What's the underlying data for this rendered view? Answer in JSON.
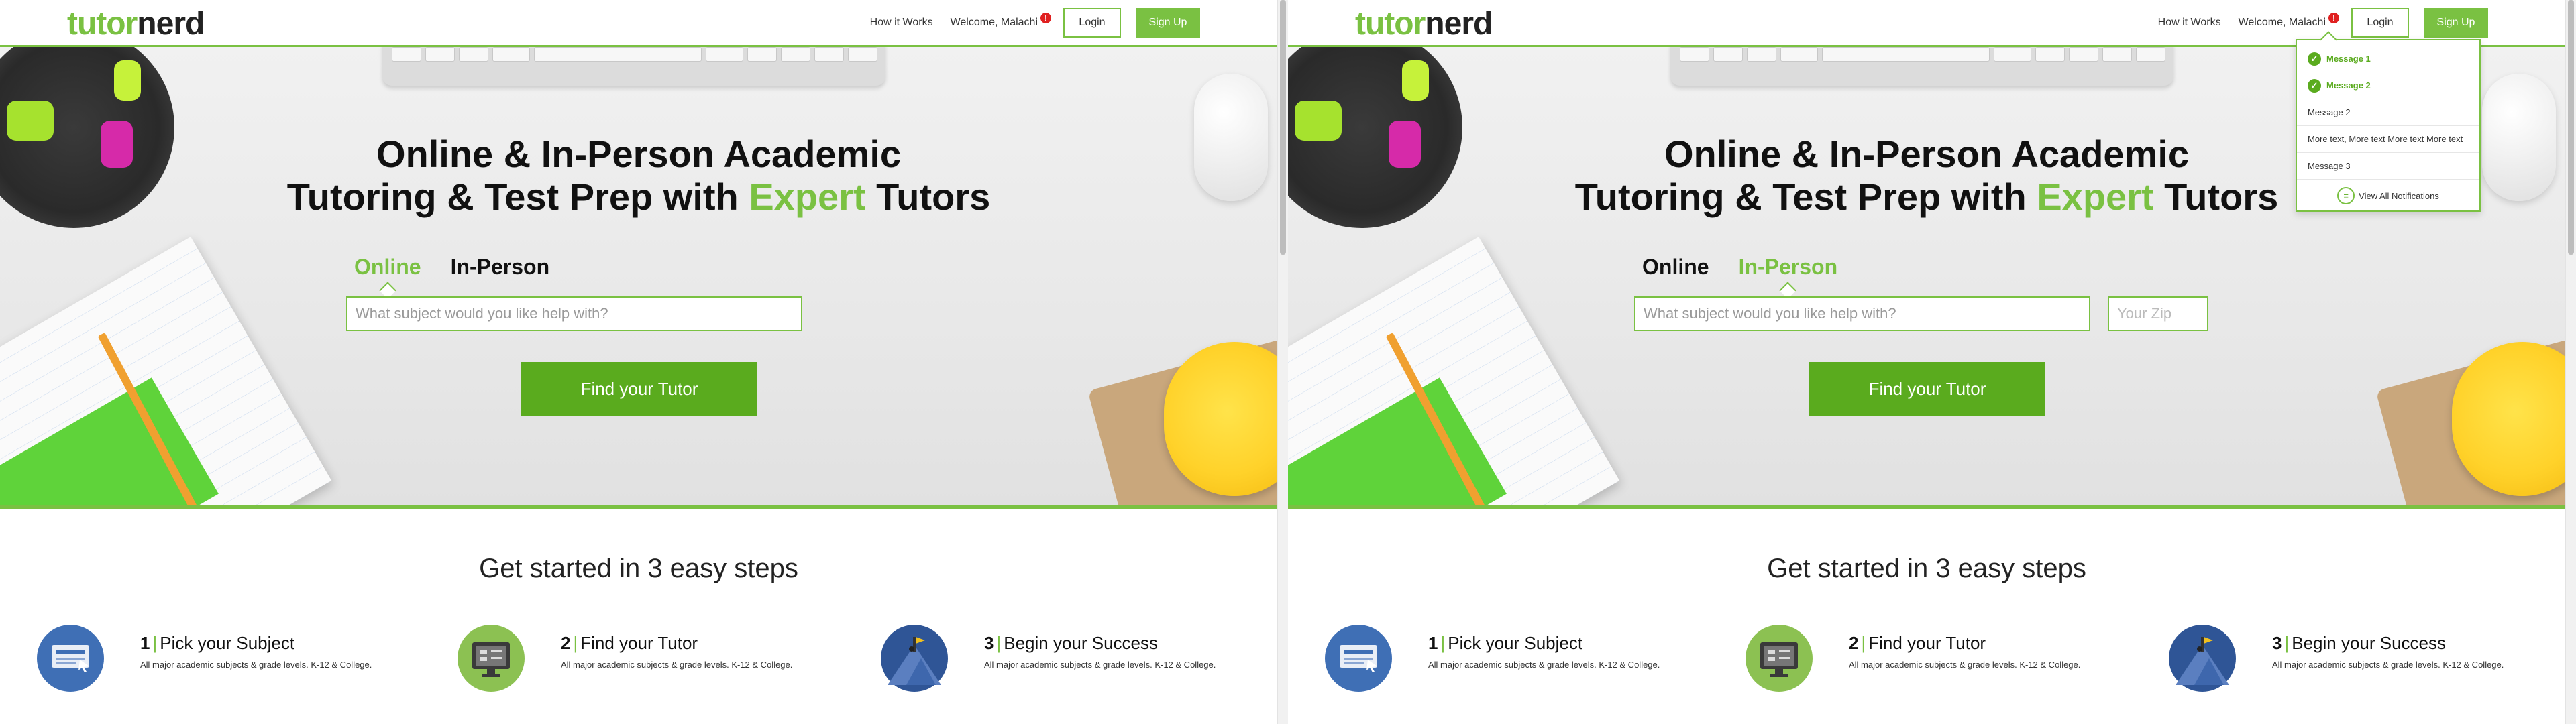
{
  "brand": {
    "logo_part1": "tutor",
    "logo_part2": "nerd"
  },
  "nav": {
    "how_it_works": "How it Works",
    "welcome": "Welcome, Malachi",
    "notification_badge": "!",
    "login": "Login",
    "signup": "Sign Up"
  },
  "hero": {
    "headline_line1": "Online & In-Person Academic",
    "headline_line2_pre": "Tutoring & Test Prep with ",
    "headline_accent": "Expert",
    "headline_line2_post": " Tutors",
    "tab_online": "Online",
    "tab_in_person": "In-Person",
    "subject_placeholder": "What subject would you like help with?",
    "zip_placeholder": "Your Zip",
    "find_button": "Find your Tutor"
  },
  "panels": [
    {
      "active_tab": "online",
      "show_zip": false,
      "show_dropdown": false
    },
    {
      "active_tab": "in-person",
      "show_zip": true,
      "show_dropdown": true
    }
  ],
  "steps": {
    "title": "Get started in 3 easy steps",
    "items": [
      {
        "number": "1",
        "label": "Pick your Subject",
        "desc": "All major academic subjects & grade levels. K-12 & College."
      },
      {
        "number": "2",
        "label": "Find your Tutor",
        "desc": "All major academic subjects & grade levels. K-12 & College."
      },
      {
        "number": "3",
        "label": "Begin your Success",
        "desc": "All major academic subjects & grade levels. K-12 & College."
      }
    ]
  },
  "notifications": {
    "items": [
      {
        "text": "Message 1",
        "unread": true
      },
      {
        "text": "Message 2",
        "unread": true
      },
      {
        "text": "Message 2",
        "unread": false
      },
      {
        "text": "More text, More text More text More text",
        "unread": false
      },
      {
        "text": "Message 3",
        "unread": false
      }
    ],
    "view_all": "View All Notifications"
  },
  "colors": {
    "brand_green": "#7ac142",
    "button_green": "#5aab1e",
    "badge_red": "#e02020"
  },
  "icons": {
    "check": "check-icon",
    "bell": "bell-icon",
    "step1": "subject-screen-icon",
    "step2": "tutor-monitor-icon",
    "step3": "climber-success-icon"
  }
}
